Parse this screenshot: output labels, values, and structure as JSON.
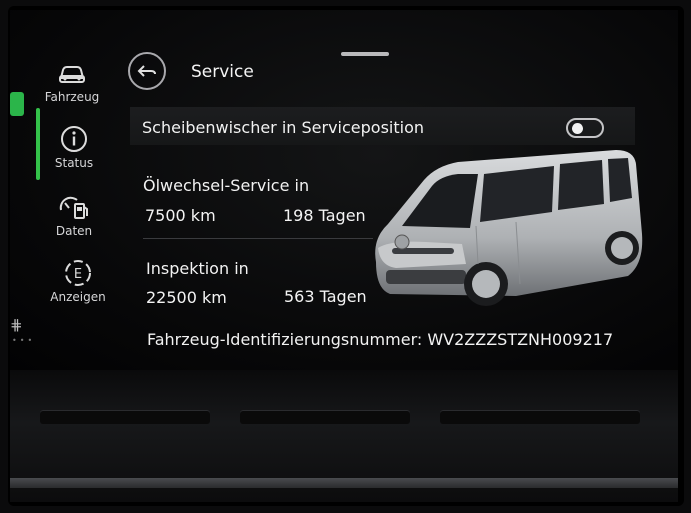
{
  "nav": {
    "items": [
      {
        "label": "Fahrzeug",
        "icon": "car-icon"
      },
      {
        "label": "Status",
        "icon": "info-icon"
      },
      {
        "label": "Daten",
        "icon": "fuel-gauge-icon"
      },
      {
        "label": "Anzeigen",
        "icon": "display-e-icon"
      }
    ],
    "active": "Status"
  },
  "header": {
    "title": "Service"
  },
  "wiper": {
    "label": "Scheibenwischer in Serviceposition",
    "enabled": false
  },
  "oil": {
    "title": "Ölwechsel-Service in",
    "distance": "7500 km",
    "days": "198 Tagen"
  },
  "inspection": {
    "title": "Inspektion in",
    "distance": "22500 km",
    "days": "563 Tagen"
  },
  "vin": {
    "text": "Fahrzeug-Identifizierungsnummer: WV2ZZZSTZNH009217"
  },
  "colors": {
    "accent": "#34c24a",
    "background": "#070708",
    "text": "#f2f2f2"
  }
}
